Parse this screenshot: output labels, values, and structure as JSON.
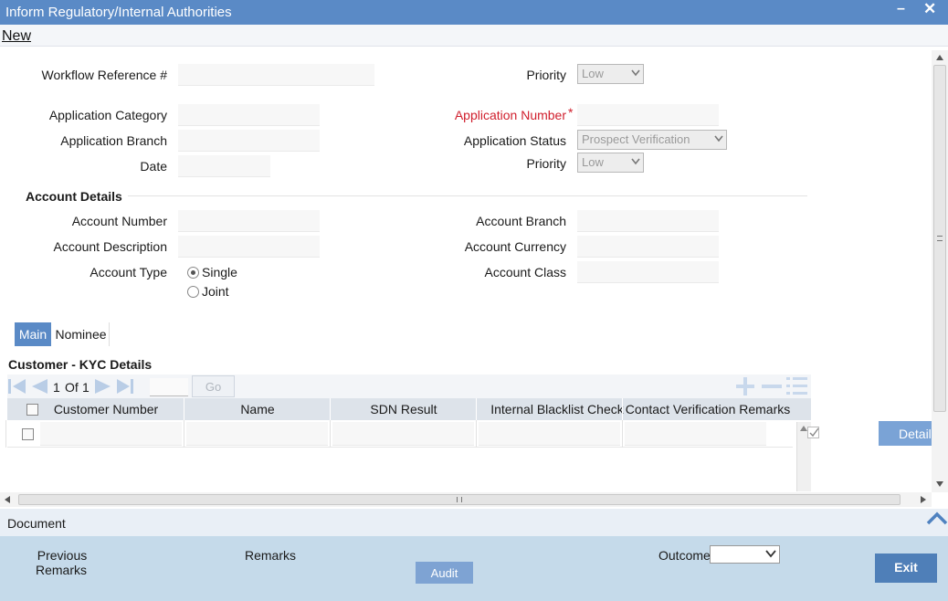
{
  "window": {
    "title": "Inform Regulatory/Internal Authorities"
  },
  "toolbar": {
    "new_label": "New"
  },
  "form": {
    "workflow_ref_label": "Workflow Reference #",
    "priority_label": "Priority",
    "priority_value": "Low",
    "app_category_label": "Application Category",
    "app_number_label": "Application Number",
    "required_mark": "*",
    "app_branch_label": "Application Branch",
    "app_status_label": "Application Status",
    "app_status_value": "Prospect Verification",
    "date_label": "Date",
    "priority2_label": "Priority",
    "priority2_value": "Low"
  },
  "account": {
    "section_title": "Account Details",
    "number_label": "Account Number",
    "branch_label": "Account Branch",
    "description_label": "Account Description",
    "currency_label": "Account Currency",
    "type_label": "Account Type",
    "class_label": "Account Class",
    "type_options": [
      "Single",
      "Joint"
    ],
    "type_selected": "Single"
  },
  "tabs": [
    {
      "label": "Main",
      "active": true
    },
    {
      "label": "Nominee",
      "active": false
    }
  ],
  "kyc": {
    "title": "Customer - KYC Details",
    "page_current": "1",
    "page_of": "Of",
    "page_total": "1",
    "go_label": "Go",
    "columns": [
      "Customer Number",
      "Name",
      "SDN Result",
      "Internal Blacklist Check",
      "Contact Verification Remarks"
    ],
    "details_label": "Details"
  },
  "document": {
    "label": "Document"
  },
  "footer": {
    "prev_remarks_label_1": "Previous",
    "prev_remarks_label_2": "Remarks",
    "remarks_label": "Remarks",
    "audit_label": "Audit",
    "outcome_label": "Outcome",
    "outcome_value": "",
    "exit_label": "Exit"
  },
  "colors": {
    "accent": "#5a8ac6",
    "footer_bg": "#c5daea",
    "required": "#d01e2c"
  }
}
